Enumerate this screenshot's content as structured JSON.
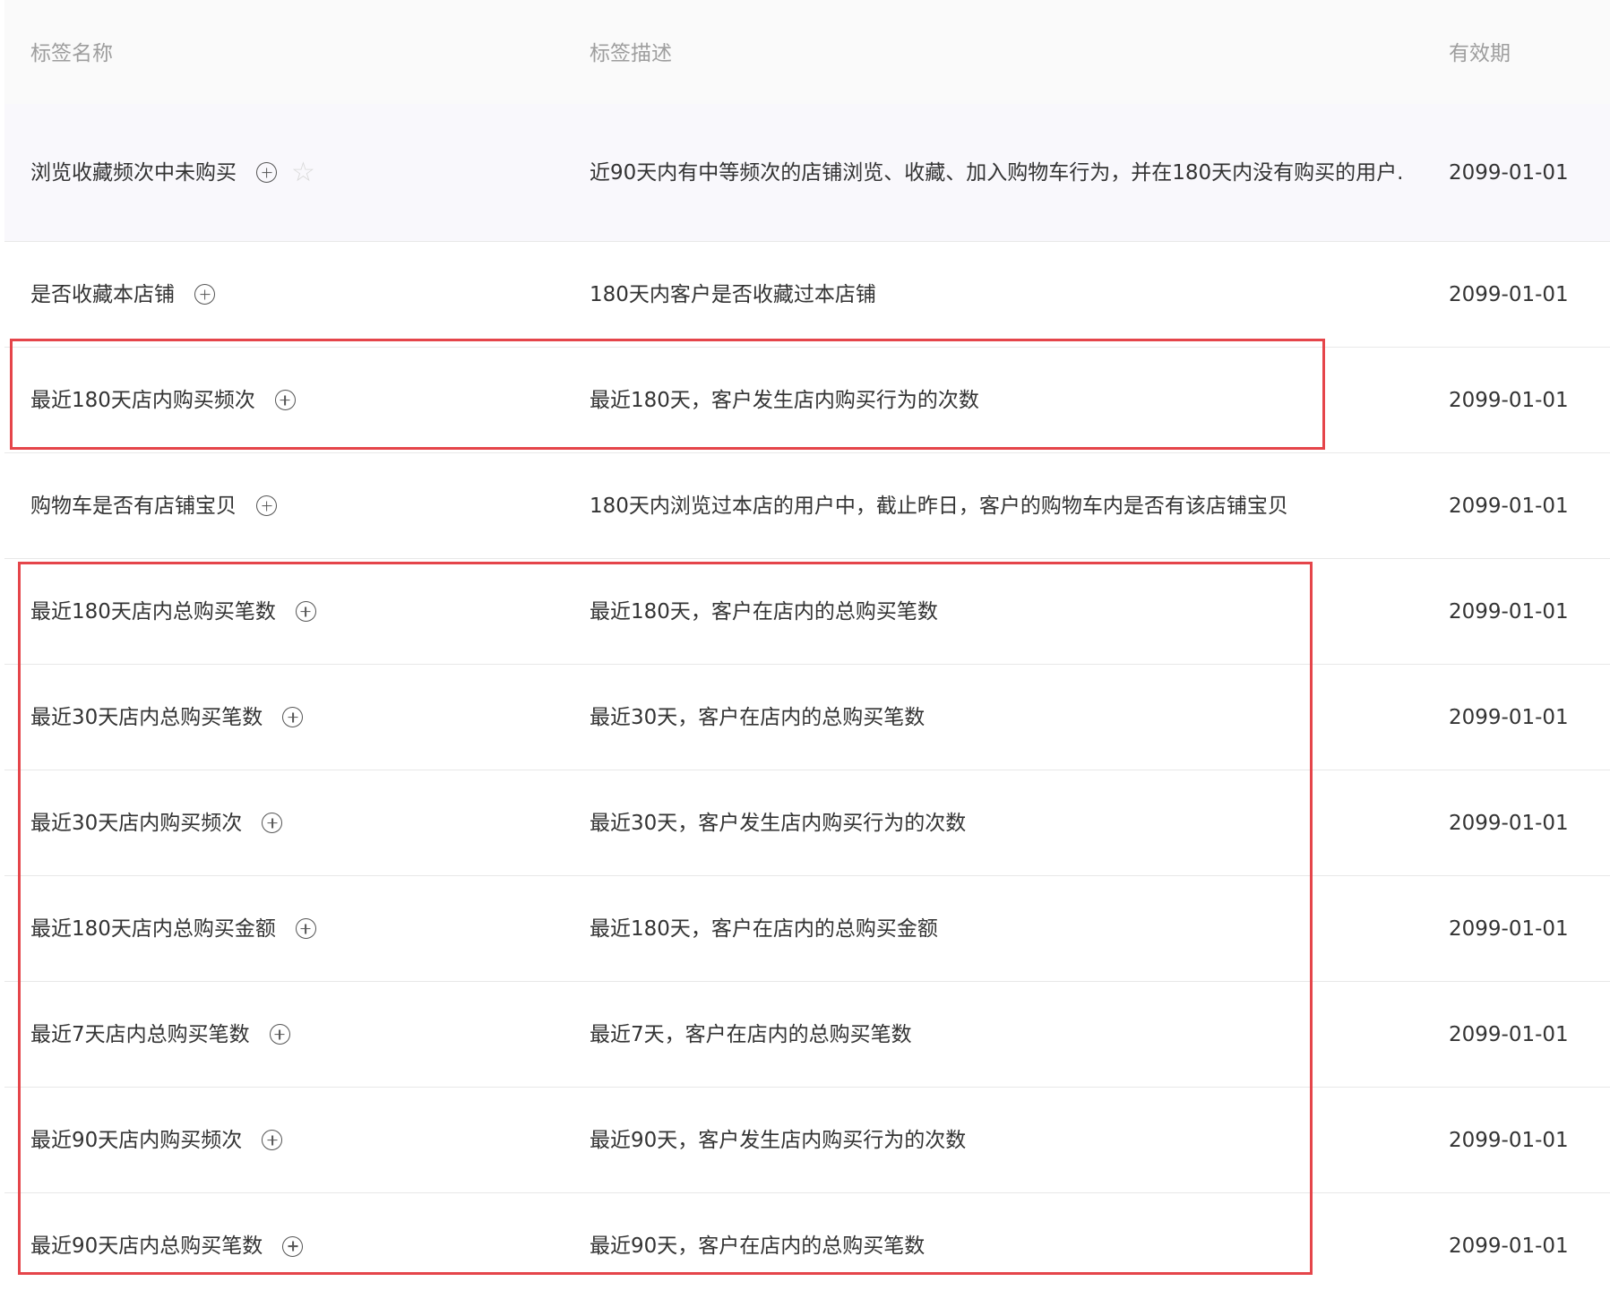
{
  "columns": {
    "name": "标签名称",
    "description": "标签描述",
    "expiry": "有效期"
  },
  "rows": [
    {
      "name": "浏览收藏频次中未购买",
      "description": "近90天内有中等频次的店铺浏览、收藏、加入购物车行为，并在180天内没有购买的用户.",
      "expiry": "2099-01-01",
      "icons": [
        "add-circle",
        "star"
      ]
    },
    {
      "name": "是否收藏本店铺",
      "description": "180天内客户是否收藏过本店铺",
      "expiry": "2099-01-01",
      "icons": [
        "add-circle"
      ]
    },
    {
      "name": "最近180天店内购买频次",
      "description": "最近180天，客户发生店内购买行为的次数",
      "expiry": "2099-01-01",
      "icons": [
        "add-circle"
      ]
    },
    {
      "name": "购物车是否有店铺宝贝",
      "description": "180天内浏览过本店的用户中，截止昨日，客户的购物车内是否有该店铺宝贝",
      "expiry": "2099-01-01",
      "icons": [
        "add-circle"
      ]
    },
    {
      "name": "最近180天店内总购买笔数",
      "description": "最近180天，客户在店内的总购买笔数",
      "expiry": "2099-01-01",
      "icons": [
        "add-circle"
      ]
    },
    {
      "name": "最近30天店内总购买笔数",
      "description": "最近30天，客户在店内的总购买笔数",
      "expiry": "2099-01-01",
      "icons": [
        "add-circle"
      ]
    },
    {
      "name": "最近30天店内购买频次",
      "description": "最近30天，客户发生店内购买行为的次数",
      "expiry": "2099-01-01",
      "icons": [
        "add-circle"
      ]
    },
    {
      "name": "最近180天店内总购买金额",
      "description": "最近180天，客户在店内的总购买金额",
      "expiry": "2099-01-01",
      "icons": [
        "add-circle"
      ]
    },
    {
      "name": "最近7天店内总购买笔数",
      "description": "最近7天，客户在店内的总购买笔数",
      "expiry": "2099-01-01",
      "icons": [
        "add-circle"
      ]
    },
    {
      "name": "最近90天店内购买频次",
      "description": "最近90天，客户发生店内购买行为的次数",
      "expiry": "2099-01-01",
      "icons": [
        "add-circle"
      ]
    },
    {
      "name": "最近90天店内总购买笔数",
      "description": "最近90天，客户在店内的总购买笔数",
      "expiry": "2099-01-01",
      "icons": [
        "add-circle"
      ]
    }
  ],
  "colors": {
    "highlight_box": "#e5454a",
    "header_bg": "#fafafa",
    "hover_row_bg": "#f9f8fc"
  }
}
